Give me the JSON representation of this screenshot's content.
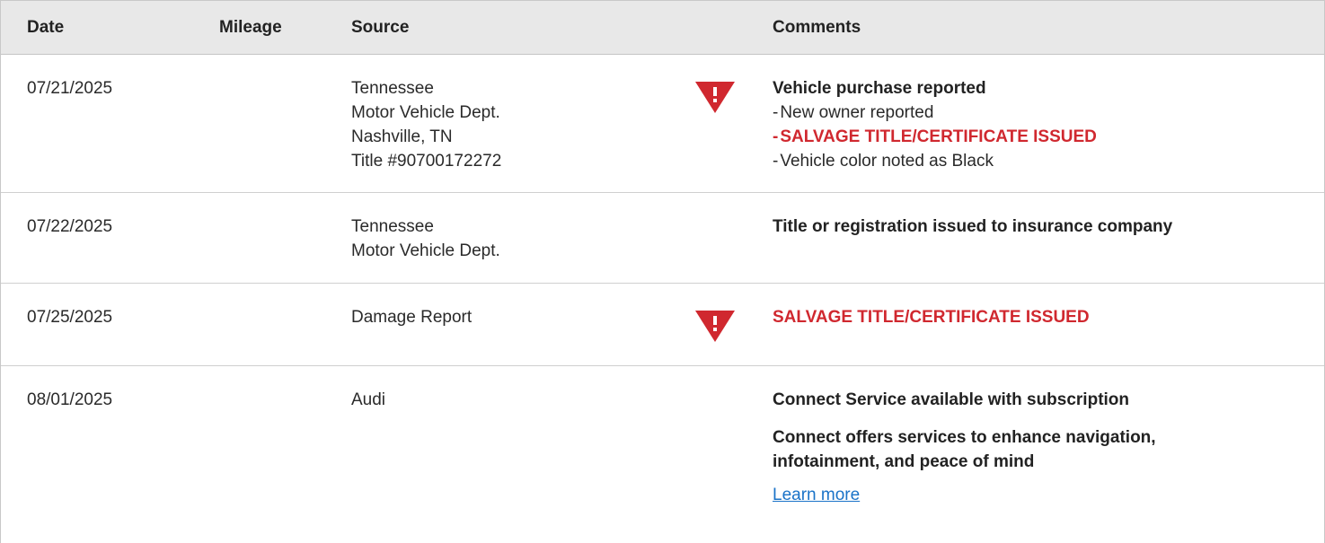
{
  "header": {
    "date": "Date",
    "mileage": "Mileage",
    "source": "Source",
    "comments": "Comments"
  },
  "colors": {
    "alert": "#d0282f",
    "header_bg": "#e8e8e8",
    "link": "#1a73c8"
  },
  "rows": [
    {
      "date": "07/21/2025",
      "mileage": "",
      "source": [
        "Tennessee",
        "Motor Vehicle Dept.",
        "Nashville, TN",
        "Title #90700172272"
      ],
      "flag_icon": "alert-triangle-icon",
      "comment_title": "Vehicle purchase reported",
      "comment_items": [
        {
          "dash": "-",
          "text": "New owner reported"
        },
        {
          "dash": "-",
          "text": "SALVAGE TITLE/CERTIFICATE ISSUED"
        },
        {
          "dash": "-",
          "text": "Vehicle color noted as Black"
        }
      ]
    },
    {
      "date": "07/22/2025",
      "mileage": "",
      "source": [
        "Tennessee",
        "Motor Vehicle Dept."
      ],
      "comment_title": "Title or registration issued to insurance company"
    },
    {
      "date": "07/25/2025",
      "mileage": "",
      "source": [
        "Damage Report"
      ],
      "flag_icon": "alert-triangle-icon",
      "comment_alert": "SALVAGE TITLE/CERTIFICATE ISSUED"
    },
    {
      "date": "08/01/2025",
      "mileage": "",
      "source": [
        "Audi"
      ],
      "comment_title": "Connect Service available with subscription",
      "comment_para_lines": [
        "Connect offers services to enhance navigation,",
        "infotainment, and peace of mind"
      ],
      "link_label": "Learn more"
    }
  ]
}
